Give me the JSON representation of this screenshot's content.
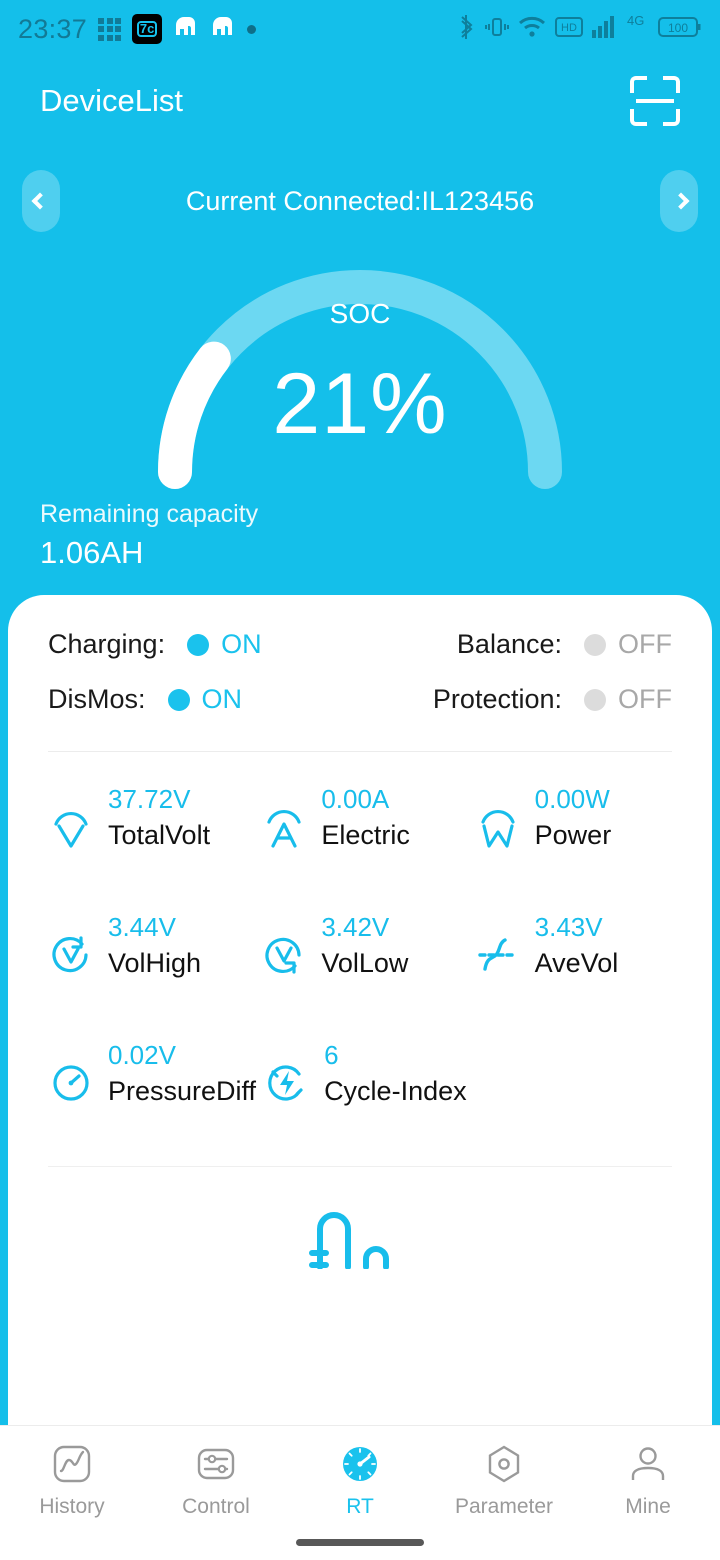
{
  "colors": {
    "brand": "#14bfea",
    "accent": "#1ac2ed",
    "track": "#6cd8f2",
    "progress": "#ffffff",
    "off_grey": "#a8a8a8",
    "nav_inactive": "#9a9a9a"
  },
  "statusbar": {
    "time": "23:37",
    "left_icons": [
      "app-grid-icon",
      "temperature-badge-icon",
      "elephant-icon",
      "elephant-icon",
      "dot-icon"
    ],
    "badge_text": "7c",
    "right_icons": [
      "bluetooth-icon",
      "vibrate-icon",
      "wifi-icon",
      "hd-icon",
      "signal-bars-icon",
      "network-4g-icon",
      "battery-icon"
    ],
    "network_label": "4G",
    "hd_label": "HD",
    "battery_level": "100"
  },
  "header": {
    "title": "DeviceList",
    "scan_icon": "scan-icon"
  },
  "device_switcher": {
    "prev_icon": "chevron-left-icon",
    "next_icon": "chevron-right-icon",
    "text": "Current Connected:IL123456"
  },
  "gauge": {
    "label": "SOC",
    "value": "21%",
    "percent": 21
  },
  "capacity": {
    "label": "Remaining capacity",
    "value": "1.06AH"
  },
  "status": [
    {
      "label": "Charging:",
      "value": "ON",
      "state": "on"
    },
    {
      "label": "Balance:",
      "value": "OFF",
      "state": "off"
    },
    {
      "label": "DisMos:",
      "value": "ON",
      "state": "on"
    },
    {
      "label": "Protection:",
      "value": "OFF",
      "state": "off"
    }
  ],
  "metrics": [
    {
      "icon": "volt-arc-icon",
      "value": "37.72V",
      "label": "TotalVolt"
    },
    {
      "icon": "ampere-arc-icon",
      "value": "0.00A",
      "label": "Electric"
    },
    {
      "icon": "watt-arc-icon",
      "value": "0.00W",
      "label": "Power"
    },
    {
      "icon": "volt-high-icon",
      "value": "3.44V",
      "label": "VolHigh"
    },
    {
      "icon": "volt-low-icon",
      "value": "3.42V",
      "label": "VolLow"
    },
    {
      "icon": "average-volt-icon",
      "value": "3.43V",
      "label": "AveVol"
    },
    {
      "icon": "gauge-dial-icon",
      "value": "0.02V",
      "label": "PressureDiff"
    },
    {
      "icon": "cycle-bolt-icon",
      "value": "6",
      "label": "Cycle-Index"
    }
  ],
  "bottom_nav": [
    {
      "icon": "history-chart-icon",
      "label": "History",
      "active": false
    },
    {
      "icon": "control-sliders-icon",
      "label": "Control",
      "active": false
    },
    {
      "icon": "rt-gauge-icon",
      "label": "RT",
      "active": true
    },
    {
      "icon": "parameter-hex-icon",
      "label": "Parameter",
      "active": false
    },
    {
      "icon": "profile-person-icon",
      "label": "Mine",
      "active": false
    }
  ]
}
